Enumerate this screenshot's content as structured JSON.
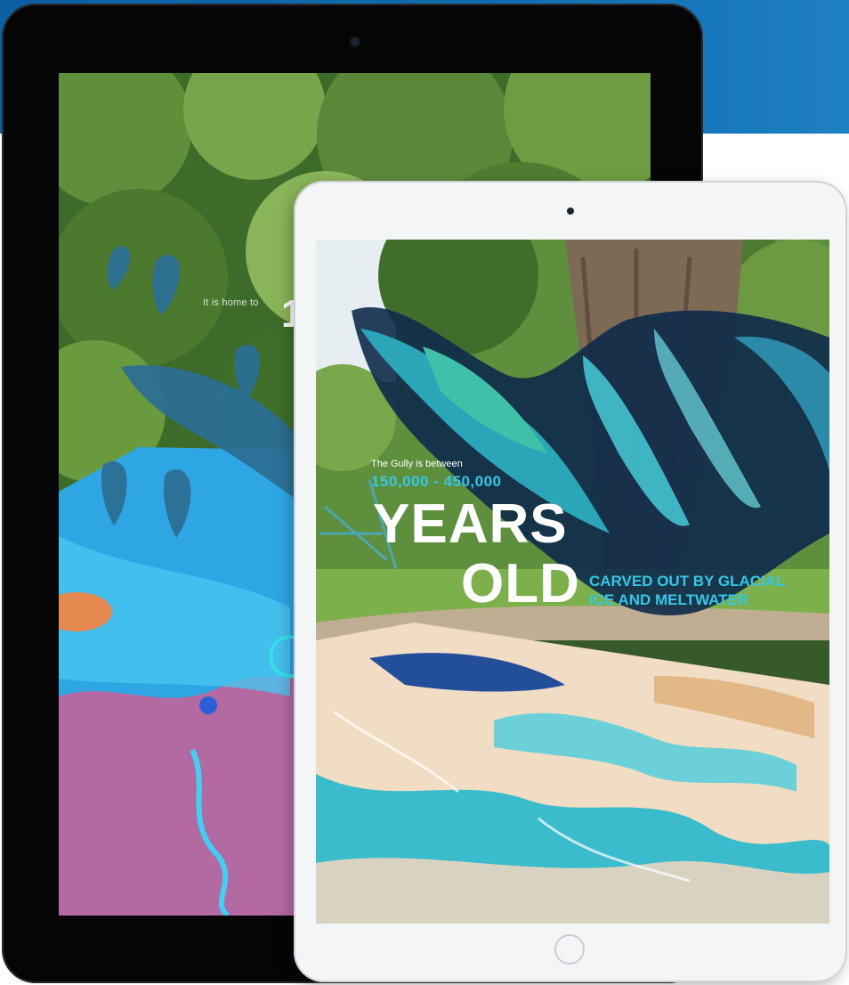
{
  "back_tablet": {
    "caption": "It is home to",
    "number_fragment": "1"
  },
  "front_tablet": {
    "intro": "The Gully is between",
    "range": "150,000 - 450,000",
    "headline_line1": "YEARS",
    "headline_line2": "OLD",
    "subline1": "CARVED OUT BY GLACIAL",
    "subline2": "ICE AND MELTWATER"
  },
  "colors": {
    "band_blue": "#0f6db4",
    "accent_cyan": "#35c7e8",
    "headline_white": "#ffffff",
    "back_bezel": "#050505",
    "front_bezel": "#f4f5f7"
  },
  "icons": [
    "front-camera-icon",
    "home-button-icon",
    "dolphin-icon",
    "whale-icon"
  ]
}
